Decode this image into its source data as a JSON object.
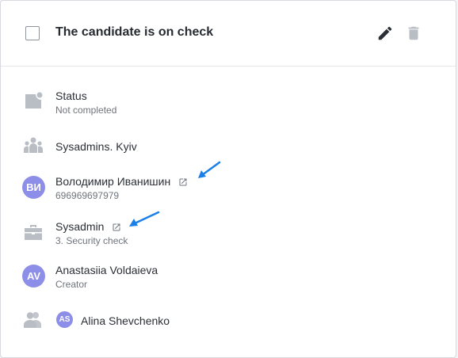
{
  "task": {
    "title": "The candidate is on check"
  },
  "details": {
    "status": {
      "label": "Status",
      "value": "Not completed"
    },
    "department": {
      "label": "Sysadmins. Kyiv"
    },
    "candidate": {
      "initials": "ВИ",
      "name": "Володимир Иванишин",
      "phone": "696969697979"
    },
    "vacancy": {
      "name": "Sysadmin",
      "stage": "3. Security check"
    },
    "creator": {
      "initials": "AV",
      "name": "Anastasiia Voldaieva",
      "role": "Creator"
    },
    "assignee": {
      "initials": "AS",
      "name": "Alina Shevchenko"
    }
  },
  "colors": {
    "avatar": "#8d8ee8",
    "icon_gray": "#b9bdc4",
    "annotation_arrow": "#1a7fe8"
  },
  "icons": [
    "pencil-icon",
    "trash-icon",
    "status-icon",
    "group-icon",
    "external-link-icon",
    "briefcase-icon",
    "people-icon"
  ]
}
